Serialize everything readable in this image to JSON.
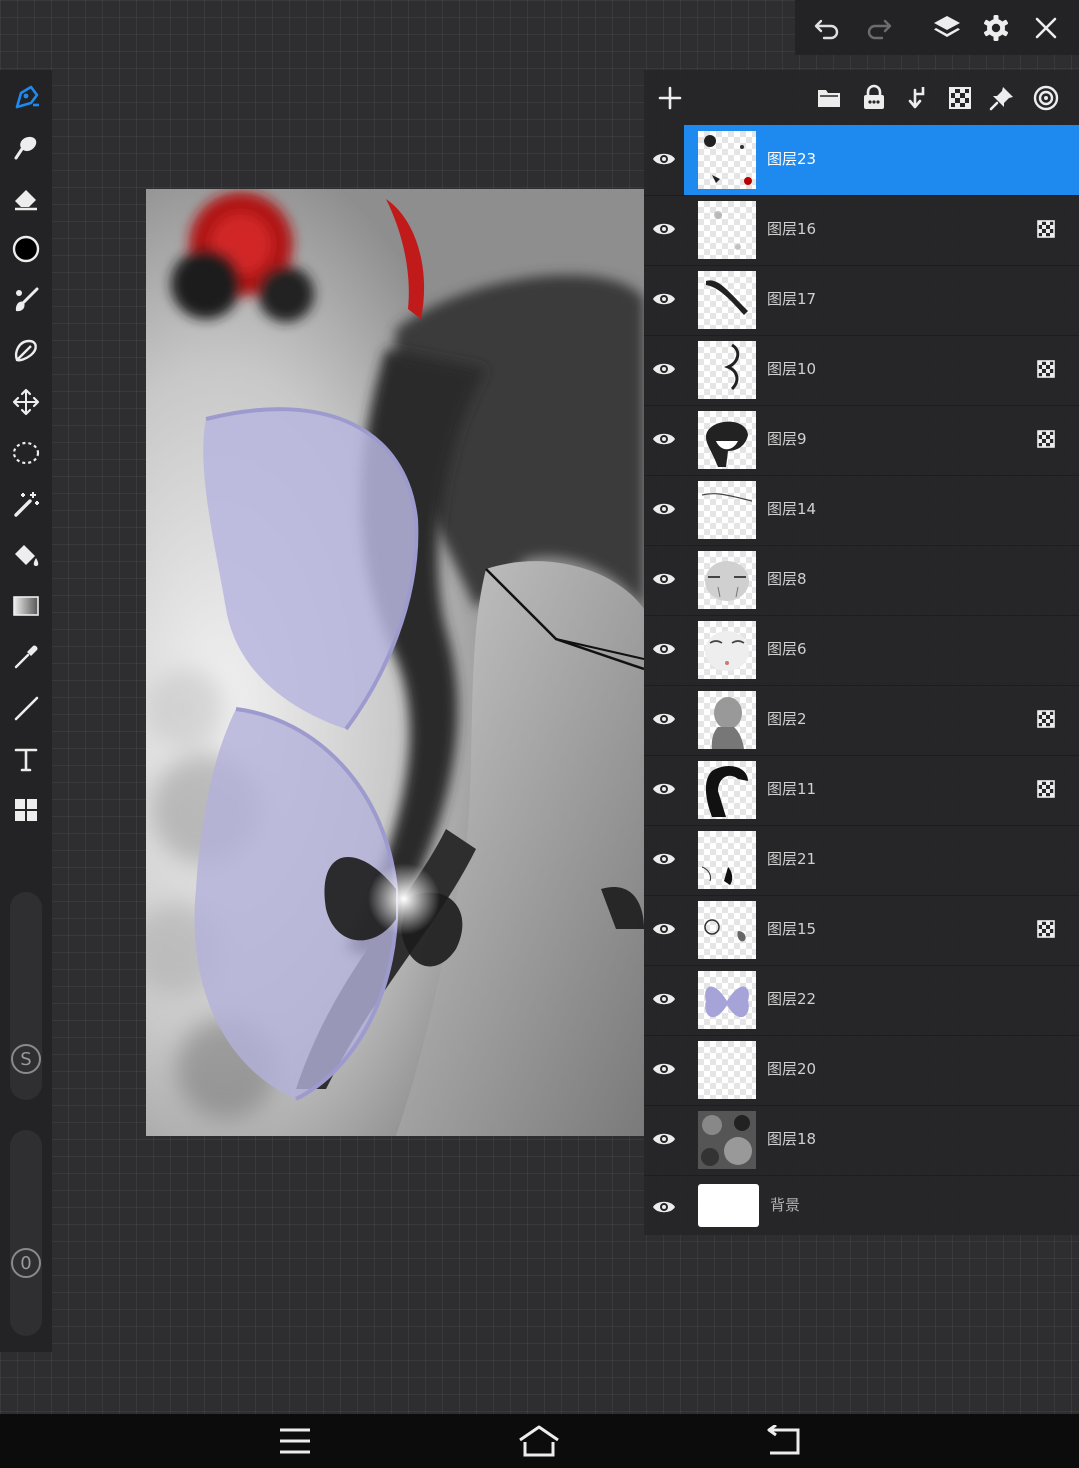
{
  "top_bar": {
    "icons": [
      "undo-icon",
      "redo-icon",
      "layers-icon",
      "settings-icon",
      "close-icon"
    ]
  },
  "toolbar": {
    "tools": [
      "pen-tool-icon",
      "smudge-icon",
      "eraser-icon",
      "color-icon",
      "brush-icon",
      "lasso-fill-icon",
      "transform-icon",
      "selection-icon",
      "magic-wand-icon",
      "paint-bucket-icon",
      "gradient-icon",
      "eyedropper-icon",
      "line-icon",
      "text-icon",
      "gallery-grid-icon"
    ],
    "size_slider_label": "S",
    "opacity_slider_label": "0"
  },
  "layers_panel": {
    "header_icons": [
      "add-layer-icon",
      "folder-icon",
      "lock-icon",
      "merge-down-icon",
      "checker-icon",
      "pin-icon",
      "target-icon"
    ],
    "layers": [
      {
        "name": "图层23",
        "active": true,
        "badge": false
      },
      {
        "name": "图层16",
        "active": false,
        "badge": true
      },
      {
        "name": "图层17",
        "active": false,
        "badge": false
      },
      {
        "name": "图层10",
        "active": false,
        "badge": true
      },
      {
        "name": "图层9",
        "active": false,
        "badge": true
      },
      {
        "name": "图层14",
        "active": false,
        "badge": false
      },
      {
        "name": "图层8",
        "active": false,
        "badge": false
      },
      {
        "name": "图层6",
        "active": false,
        "badge": false
      },
      {
        "name": "图层2",
        "active": false,
        "badge": true
      },
      {
        "name": "图层11",
        "active": false,
        "badge": true
      },
      {
        "name": "图层21",
        "active": false,
        "badge": false
      },
      {
        "name": "图层15",
        "active": false,
        "badge": true
      },
      {
        "name": "图层22",
        "active": false,
        "badge": false
      },
      {
        "name": "图层20",
        "active": false,
        "badge": false
      },
      {
        "name": "图层18",
        "active": false,
        "badge": false
      }
    ],
    "background_layer": "背景"
  },
  "colors": {
    "accent": "#1e8af0",
    "panel": "#262628",
    "icon": "#e8e8e8",
    "active_tool": "#1e8af0"
  },
  "nav_bar": {
    "icons": [
      "menu-icon",
      "home-icon",
      "back-icon"
    ]
  }
}
